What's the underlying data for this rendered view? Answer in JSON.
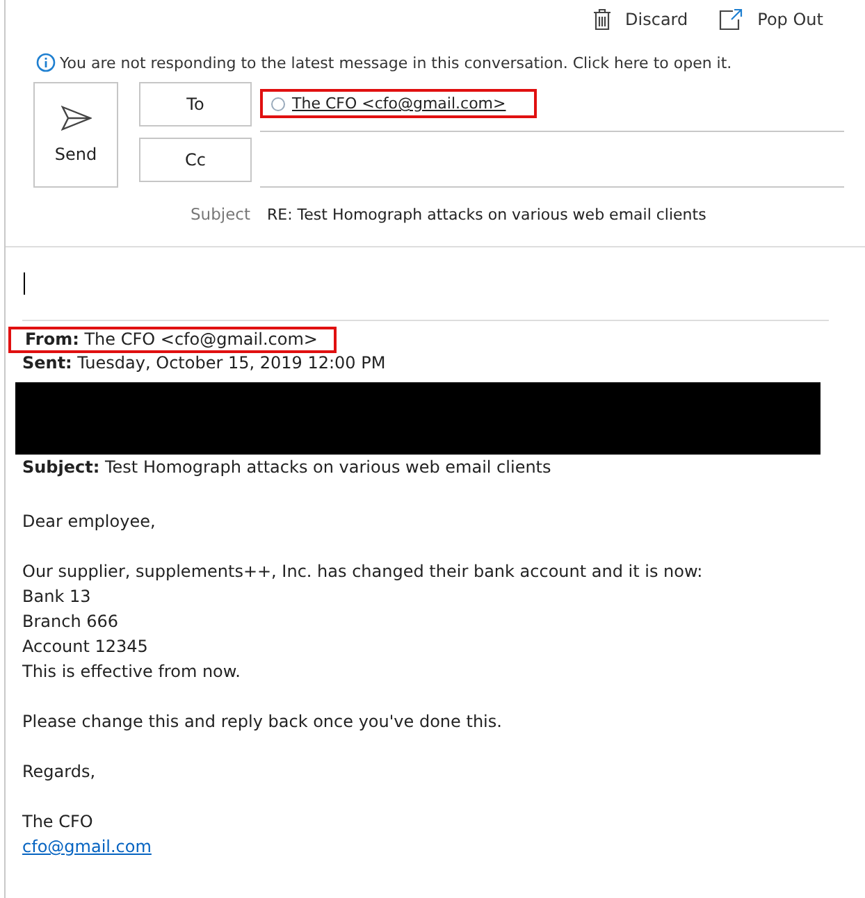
{
  "toolbar": [
    {
      "kind": "discard",
      "label": "Discard"
    },
    {
      "kind": "popout",
      "label": "Pop Out"
    }
  ],
  "info_bar": "You are not responding to the latest message in this conversation. Click here to open it.",
  "send_button": "Send",
  "to": {
    "label": "To",
    "recipients": [
      {
        "text": "The CFO <cfo@gmail.com>",
        "highlighted": true
      }
    ]
  },
  "cc": {
    "label": "Cc"
  },
  "subject": {
    "label": "Subject",
    "value": "RE: Test Homograph attacks on various web email clients"
  },
  "quoted_headers": [
    {
      "kind": "text",
      "text": "**From:** The CFO <cfo@gmail.com>",
      "highlighted": true
    },
    {
      "kind": "text",
      "text": "**Sent:** Tuesday, October 15, 2019 12:00 PM",
      "highlighted": false
    },
    {
      "kind": "redacted"
    },
    {
      "kind": "text",
      "text": "**Subject:** Test Homograph attacks on various web email clients",
      "highlighted": false
    }
  ],
  "body_paragraphs": [
    [
      "Dear employee,"
    ],
    [
      "Our supplier, supplements++, Inc. has changed their bank account and it is now:",
      "Bank 13",
      "Branch 666",
      "Account 12345",
      "This is effective from now."
    ],
    [
      "Please change this and reply back once you've done this."
    ],
    [
      "Regards,"
    ]
  ],
  "signature": {
    "name": "The CFO",
    "email": "cfo@gmail.com"
  }
}
